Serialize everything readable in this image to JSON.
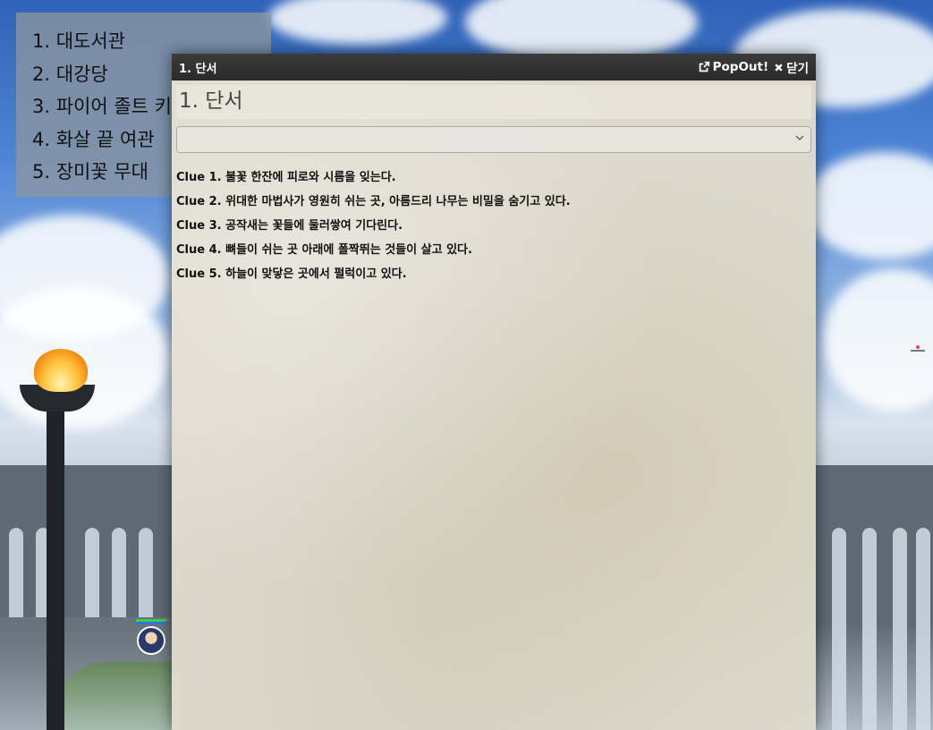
{
  "locations": [
    "1. 대도서관",
    "2. 대강당",
    "3. 파이어 졸트 키",
    "4. 화살 끝 여관",
    "5. 장미꽃 무대"
  ],
  "dialog": {
    "window_title": "1. 단서",
    "popout_label": "PopOut!",
    "close_label": "닫기",
    "doc_title": "1. 단서",
    "select_value": "",
    "clues": [
      "Clue 1. 불꽃 한잔에 피로와 시름을 잊는다.",
      "Clue 2. 위대한 마법사가 영원히 쉬는 곳, 아름드리 나무는 비밀을 숨기고 있다.",
      "Clue 3. 공작새는 꽃들에 둘러쌓여 기다린다.",
      "Clue 4. 뼈들이 쉬는 곳 아래에 폴짝뛰는 것들이 살고 있다.",
      "Clue 5. 하늘이 맞닿은 곳에서 펄럭이고 있다."
    ]
  },
  "icons": {
    "popout": "external-link-icon",
    "close": "x-icon",
    "dropdown": "chevron-down-icon"
  },
  "colors": {
    "titlebar": "#2e2e2e",
    "parchment": "#ddd8cb",
    "list_panel": "#8c96a0"
  }
}
